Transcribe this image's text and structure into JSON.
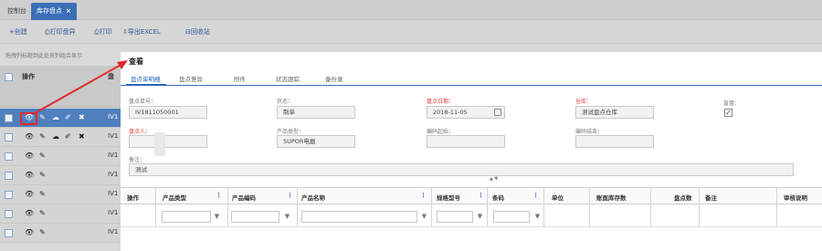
{
  "tabs": [
    {
      "label": "控制台"
    },
    {
      "label": "库存盘点",
      "close": "×"
    }
  ],
  "toolbar": {
    "new": "+创建",
    "print_inventory": "⎙打印盘异",
    "print": "⎙打印",
    "export": "⇩导出EXCEL",
    "recycle": "⊟回收站"
  },
  "grid_hint": "拖拽列标题到此处按列组合显示",
  "grid": {
    "col_actions": "操作",
    "col_code": "盘",
    "row_code_prefix": "IV1"
  },
  "dialog": {
    "title": "查看",
    "tabs": [
      "盘点单明细",
      "盘点差异",
      "附件",
      "状态跟踪",
      "备份录"
    ],
    "fields": {
      "order_no_label": "盘点单号：",
      "order_no_value": "IV1811050001",
      "status_label": "状态：",
      "status_value": "制单",
      "date_label": "盘点日期：",
      "date_value": "2018-11-05",
      "warehouse_label": "仓库：",
      "warehouse_value": "测试盘点仓库",
      "blind_label": "盲盘：",
      "blind_checked": "✓",
      "person_label": "盘点人：",
      "person_value": "",
      "category_label": "产品类型：",
      "category_value": "SUPOR电器",
      "code_start_label": "编码起始：",
      "code_start_value": "",
      "code_end_label": "编码结束：",
      "code_end_value": "",
      "remark_label": "备注：",
      "remark_value": "测试"
    },
    "table_headers": [
      "操作",
      "产品类型",
      "产品编码",
      "产品名称",
      "规格型号",
      "条码",
      "单位",
      "账面库存数",
      "盘点数",
      "备注",
      "审核说明"
    ],
    "filter_icon": "funnel-icon",
    "splitter": "▲ ▼"
  },
  "colors": {
    "accent": "#3b6fb6",
    "required": "#e03b3b",
    "highlight_box": "#e02b2b"
  }
}
